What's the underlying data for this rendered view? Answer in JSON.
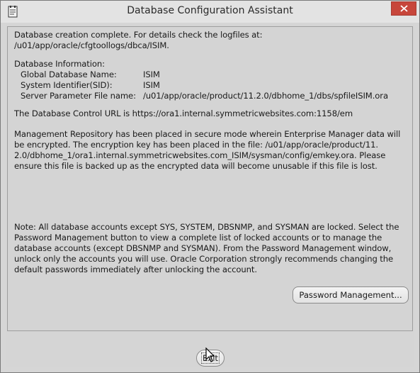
{
  "window": {
    "title": "Database Configuration Assistant",
    "title_icon": "document-icon",
    "close_icon": "close-icon"
  },
  "intro": {
    "line1": "Database creation complete. For details check the logfiles at:",
    "line2": " /u01/app/oracle/cfgtoollogs/dbca/ISIM."
  },
  "db_info": {
    "heading": "Database Information:",
    "rows": [
      {
        "label": "Global Database Name:",
        "value": "ISIM"
      },
      {
        "label": "System Identifier(SID):",
        "value": "ISIM"
      },
      {
        "label": "Server Parameter File name:",
        "value": "/u01/app/oracle/product/11.2.0/dbhome_1/dbs/spfileISIM.ora"
      }
    ]
  },
  "control_url": "The Database Control URL is https://ora1.internal.symmetricwebsites.com:1158/em",
  "repository": {
    "lines": [
      "Management Repository has been placed in secure mode wherein Enterprise Manager data will",
      "be encrypted.  The encryption key has been placed in the file: /u01/app/oracle/product/11.",
      "2.0/dbhome_1/ora1.internal.symmetricwebsites.com_ISIM/sysman/config/emkey.ora.   Please",
      "ensure this file is backed up as the encrypted data will become unusable if this file is lost."
    ]
  },
  "note": {
    "lines": [
      "Note: All database accounts except SYS, SYSTEM, DBSNMP, and SYSMAN are locked. Select the",
      "Password Management button to view a complete list of locked accounts or to manage the",
      "database accounts (except DBSNMP and SYSMAN). From the Password Management window,",
      "unlock only the accounts you will use. Oracle Corporation strongly recommends changing the",
      "default passwords immediately after unlocking the account."
    ]
  },
  "buttons": {
    "password_management": "Password Management...",
    "exit": "Exit"
  },
  "colors": {
    "close_button": "#c7463b",
    "background": "#d6d6d6"
  }
}
